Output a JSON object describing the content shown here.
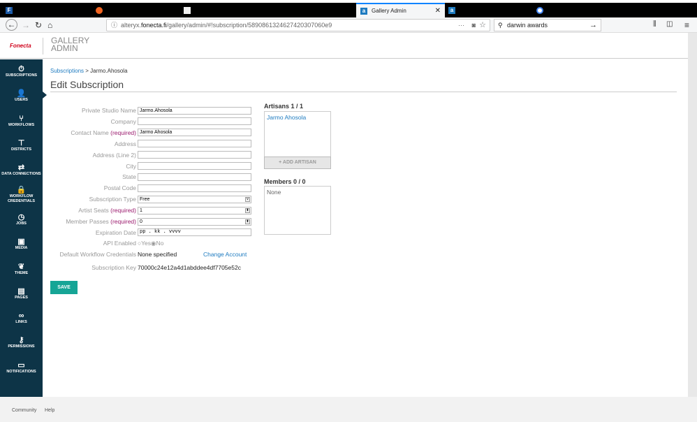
{
  "browser": {
    "active_tab": "Gallery Admin",
    "url_prefix": "alteryx.",
    "url_domain": "fonecta.fi",
    "url_path": "/gallery/admin/#!subscription/5890861324627420307060e9",
    "search": "darwin awards",
    "tab_icons": [
      "F",
      "a"
    ]
  },
  "header": {
    "logo": "Fonecta",
    "title_line1": "GALLERY",
    "title_line2": "ADMIN"
  },
  "sidebar": [
    {
      "label": "SUBSCRIPTIONS",
      "icon": "⏱"
    },
    {
      "label": "USERS",
      "icon": "👤"
    },
    {
      "label": "WORKFLOWS",
      "icon": "⑂"
    },
    {
      "label": "DISTRICTS",
      "icon": "⊤"
    },
    {
      "label": "DATA CONNECTIONS",
      "icon": "⇄"
    },
    {
      "label": "WORKFLOW CREDENTIALS",
      "icon": "🔒"
    },
    {
      "label": "JOBS",
      "icon": "◷"
    },
    {
      "label": "MEDIA",
      "icon": "▣"
    },
    {
      "label": "THEME",
      "icon": "❦"
    },
    {
      "label": "PAGES",
      "icon": "▤"
    },
    {
      "label": "LINKS",
      "icon": "∞"
    },
    {
      "label": "PERMISSIONS",
      "icon": "⚷"
    },
    {
      "label": "NOTIFICATIONS",
      "icon": "▭"
    }
  ],
  "breadcrumb": {
    "parent": "Subscriptions",
    "sep": " > ",
    "current": "Jarmo.Ahosola"
  },
  "title": "Edit Subscription",
  "required": "(required)",
  "form": {
    "studio_name": {
      "label": "Private Studio Name",
      "value": "Jarmo.Ahosola"
    },
    "company": {
      "label": "Company",
      "value": ""
    },
    "contact": {
      "label": "Contact Name",
      "value": "Jarmo Ahosola"
    },
    "address": {
      "label": "Address",
      "value": ""
    },
    "address2": {
      "label": "Address (Line 2)",
      "value": ""
    },
    "city": {
      "label": "City",
      "value": ""
    },
    "state": {
      "label": "State",
      "value": ""
    },
    "postal": {
      "label": "Postal Code",
      "value": ""
    },
    "sub_type": {
      "label": "Subscription Type",
      "value": "Free"
    },
    "artist_seats": {
      "label": "Artist Seats",
      "value": "1"
    },
    "member_passes": {
      "label": "Member Passes",
      "value": "0"
    },
    "expiration": {
      "label": "Expiration Date",
      "value": "pp . kk . vvvv"
    },
    "api": {
      "label": "API Enabled",
      "yes": "Yes",
      "no": "No",
      "selected": "No"
    },
    "credentials": {
      "label": "Default Workflow Credentials",
      "value": "None specified",
      "link": "Change Account"
    },
    "key": {
      "label": "Subscription Key",
      "value": "70000c24e12a4d1abddee4df7705e52c"
    }
  },
  "artisans": {
    "heading": "Artisans 1 / 1",
    "items": [
      "Jarmo Ahosola"
    ],
    "add": "+ ADD ARTISAN"
  },
  "members": {
    "heading": "Members 0 / 0",
    "empty": "None"
  },
  "save": "SAVE",
  "footer": {
    "community": "Community",
    "help": "Help"
  }
}
